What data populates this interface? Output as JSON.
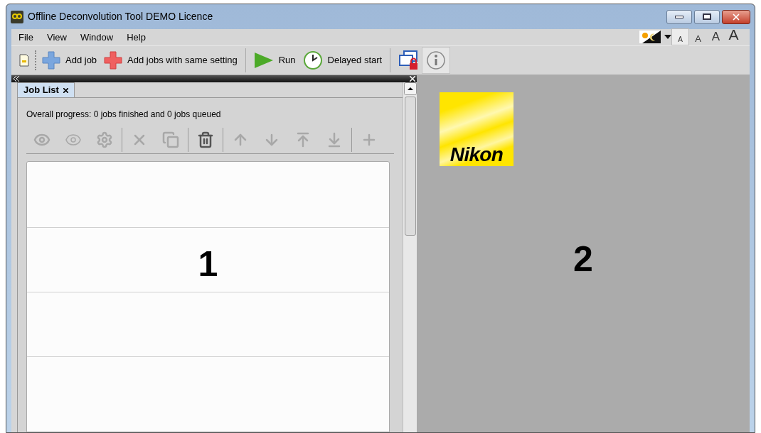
{
  "window": {
    "title": "Offline Deconvolution Tool DEMO Licence"
  },
  "menu": [
    "File",
    "View",
    "Window",
    "Help"
  ],
  "font_sizes": [
    {
      "label": "A",
      "selected": true
    },
    {
      "label": "A",
      "selected": false
    },
    {
      "label": "A",
      "selected": false
    },
    {
      "label": "A",
      "selected": false
    }
  ],
  "toolbar": [
    {
      "kind": "new"
    },
    {
      "kind": "add",
      "label": "Add job"
    },
    {
      "kind": "add_same",
      "label": "Add jobs with same setting"
    },
    {
      "kind": "run",
      "label": "Run"
    },
    {
      "kind": "delayed",
      "label": "Delayed start"
    },
    {
      "kind": "lock"
    },
    {
      "kind": "info",
      "selected": true
    }
  ],
  "job_panel": {
    "tab": "Job List",
    "progress": "Overall progress: 0 jobs finished and 0 jobs queued",
    "tools": [
      {
        "kind": "eye1",
        "enabled": false
      },
      {
        "kind": "eye2",
        "enabled": false
      },
      {
        "kind": "gear",
        "enabled": false
      },
      {
        "kind": "sep"
      },
      {
        "kind": "delete",
        "enabled": false
      },
      {
        "kind": "delete_copy",
        "enabled": false
      },
      {
        "kind": "sep"
      },
      {
        "kind": "trash_run",
        "enabled": true
      },
      {
        "kind": "sep"
      },
      {
        "kind": "up",
        "enabled": false
      },
      {
        "kind": "down",
        "enabled": false
      },
      {
        "kind": "top",
        "enabled": false
      },
      {
        "kind": "bottom",
        "enabled": false
      },
      {
        "kind": "sep"
      },
      {
        "kind": "plus",
        "enabled": false
      }
    ],
    "annotation": "1"
  },
  "viewer": {
    "logo_text": "Nikon",
    "annotation": "2"
  }
}
